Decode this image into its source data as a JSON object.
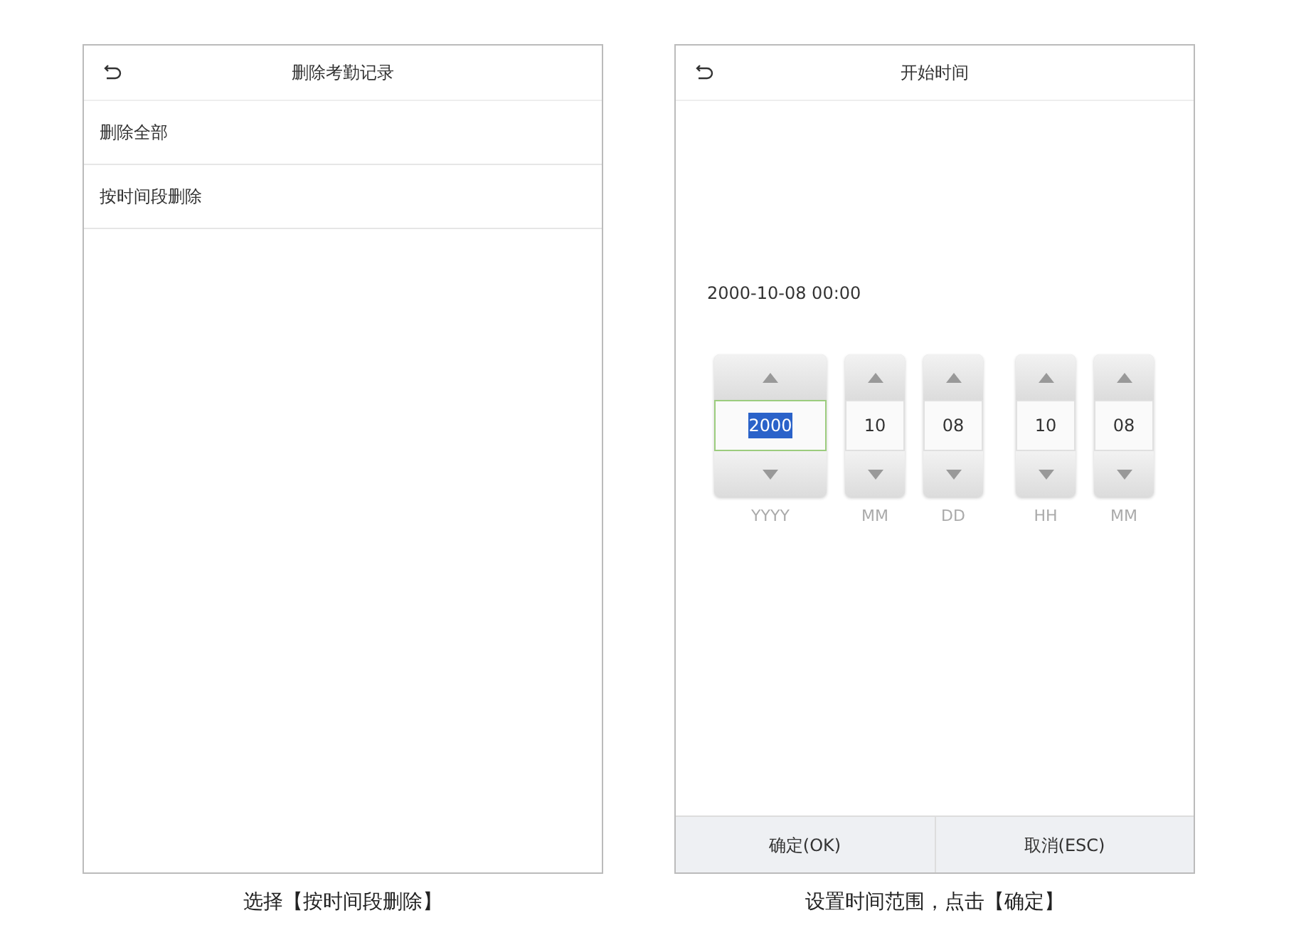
{
  "screens": [
    {
      "title": "删除考勤记录",
      "menu_items": [
        "删除全部",
        "按时间段删除"
      ],
      "caption": "选择【按时间段删除】"
    },
    {
      "title": "开始时间",
      "current_value": "2000-10-08  00:00",
      "date_fields": [
        {
          "value": "2000",
          "label": "YYYY",
          "selected": true
        },
        {
          "value": "10",
          "label": "MM",
          "selected": false
        },
        {
          "value": "08",
          "label": "DD",
          "selected": false
        }
      ],
      "time_fields": [
        {
          "value": "10",
          "label": "HH",
          "selected": false
        },
        {
          "value": "08",
          "label": "MM",
          "selected": false
        }
      ],
      "buttons": [
        "确定(OK)",
        "取消(ESC)"
      ],
      "caption": "设置时间范围，点击【确定】"
    }
  ]
}
